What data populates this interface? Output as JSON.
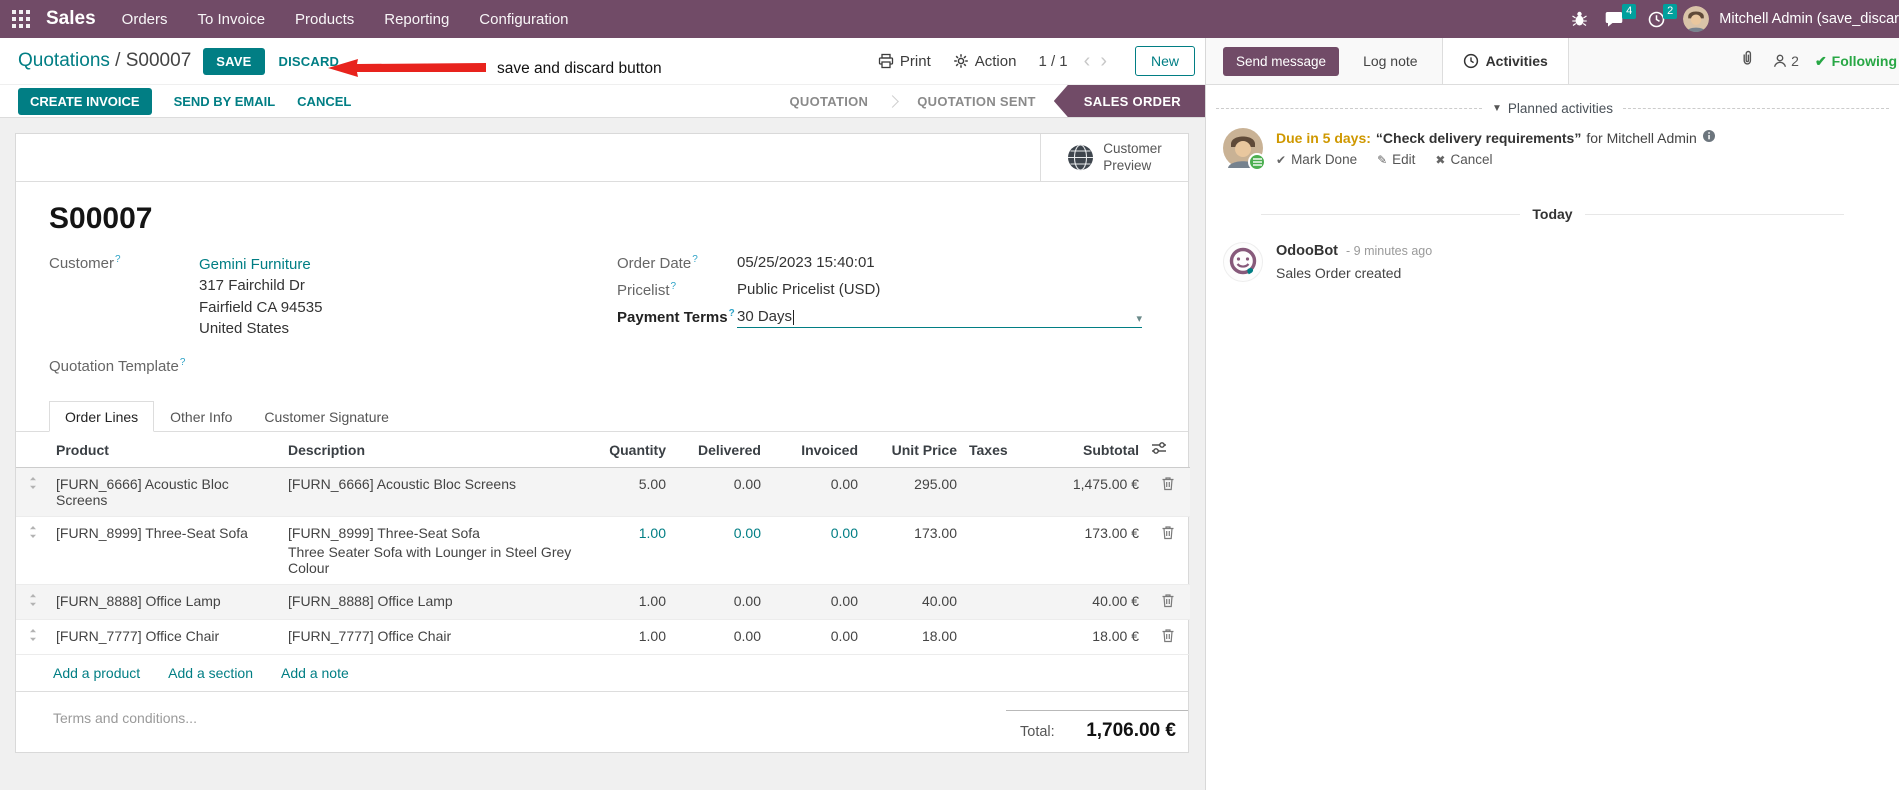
{
  "colors": {
    "brand": "#714B67",
    "primary": "#017E84",
    "badge": "#00A09D",
    "following_green": "#28a745",
    "due_amber": "#cf9800",
    "annotation_red": "#e8231d"
  },
  "navbar": {
    "app_name": "Sales",
    "menus": [
      "Orders",
      "To Invoice",
      "Products",
      "Reporting",
      "Configuration"
    ],
    "message_count": "4",
    "activity_count": "2",
    "user_name": "Mitchell Admin (save_discar"
  },
  "control_panel": {
    "breadcrumb_parent": "Quotations",
    "breadcrumb_sep": " / ",
    "breadcrumb_current": "S00007",
    "save_label": "SAVE",
    "discard_label": "DISCARD",
    "annotation_text": "save and discard button",
    "print_label": "Print",
    "action_label": "Action",
    "pager": "1 / 1",
    "prev": "‹",
    "next": "›",
    "new_label": "New"
  },
  "action_buttons": {
    "create_invoice": "CREATE INVOICE",
    "send_by_email": "SEND BY EMAIL",
    "cancel": "CANCEL"
  },
  "statusbar": {
    "steps": [
      "QUOTATION",
      "QUOTATION SENT",
      "SALES ORDER"
    ],
    "active_step": "SALES ORDER"
  },
  "ui": {
    "help": "?",
    "caret": "▾"
  },
  "sheet": {
    "customer_preview_line1": "Customer",
    "customer_preview_line2": "Preview",
    "record_name": "S00007",
    "customer": {
      "label": "Customer",
      "name": "Gemini Furniture",
      "street": "317 Fairchild Dr",
      "city": "Fairfield CA 94535",
      "country": "United States"
    },
    "order_date": {
      "label": "Order Date",
      "value": "05/25/2023 15:40:01"
    },
    "pricelist": {
      "label": "Pricelist",
      "value": "Public Pricelist (USD)"
    },
    "payment_terms": {
      "label": "Payment Terms",
      "value": "30 Days"
    },
    "quotation_template": {
      "label": "Quotation Template"
    },
    "tabs": [
      "Order Lines",
      "Other Info",
      "Customer Signature"
    ]
  },
  "order_lines": {
    "headers": {
      "product": "Product",
      "description": "Description",
      "quantity": "Quantity",
      "delivered": "Delivered",
      "invoiced": "Invoiced",
      "unit_price": "Unit Price",
      "taxes": "Taxes",
      "subtotal": "Subtotal"
    },
    "rows": [
      {
        "product": "[FURN_6666] Acoustic Bloc Screens",
        "description": "[FURN_6666] Acoustic Bloc Screens",
        "description2": "",
        "quantity": "5.00",
        "delivered": "0.00",
        "invoiced": "0.00",
        "unit_price": "295.00",
        "taxes": "",
        "subtotal": "1,475.00 €"
      },
      {
        "product": "[FURN_8999] Three-Seat Sofa",
        "description": "[FURN_8999] Three-Seat Sofa",
        "description2": "Three Seater Sofa with Lounger in Steel Grey Colour",
        "quantity": "1.00",
        "delivered": "0.00",
        "invoiced": "0.00",
        "unit_price": "173.00",
        "taxes": "",
        "subtotal": "173.00 €"
      },
      {
        "product": "[FURN_8888] Office Lamp",
        "description": "[FURN_8888] Office Lamp",
        "description2": "",
        "quantity": "1.00",
        "delivered": "0.00",
        "invoiced": "0.00",
        "unit_price": "40.00",
        "taxes": "",
        "subtotal": "40.00 €"
      },
      {
        "product": "[FURN_7777] Office Chair",
        "description": "[FURN_7777] Office Chair",
        "description2": "",
        "quantity": "1.00",
        "delivered": "0.00",
        "invoiced": "0.00",
        "unit_price": "18.00",
        "taxes": "",
        "subtotal": "18.00 €"
      }
    ],
    "add_product": "Add a product",
    "add_section": "Add a section",
    "add_note": "Add a note",
    "terms_placeholder": "Terms and conditions...",
    "total_label": "Total:",
    "total_value": "1,706.00 €"
  },
  "chatter": {
    "send_message": "Send message",
    "log_note": "Log note",
    "activities": "Activities",
    "follower_count": "2",
    "following": "Following",
    "planned_title": "Planned activities",
    "activity": {
      "due": "Due in 5 days:",
      "summary": "“Check delivery requirements”",
      "assignee": "for Mitchell Admin",
      "mark_done": "Mark Done",
      "edit": "Edit",
      "cancel": "Cancel",
      "check_glyph": "✔",
      "edit_glyph": "✎",
      "cancel_glyph": "✖"
    },
    "today": "Today",
    "message": {
      "author": "OdooBot",
      "time": "- 9 minutes ago",
      "body": "Sales Order created"
    }
  }
}
